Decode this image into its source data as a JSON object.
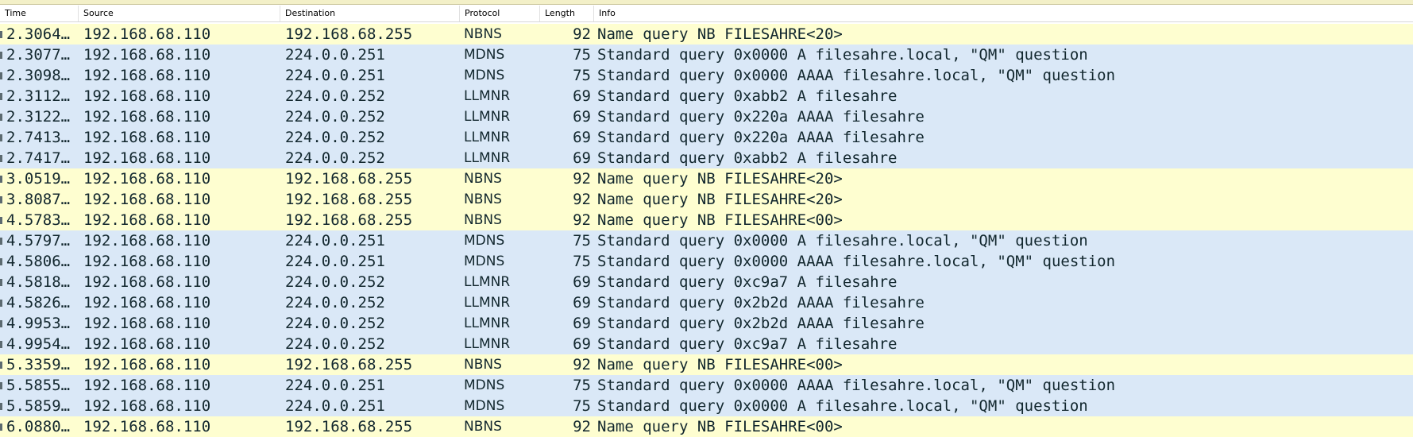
{
  "colors": {
    "nbns_row": "#fefed0",
    "mdns_row": "#dae8f7",
    "llmnr_row": "#dae8f7",
    "row_text": "#12272e"
  },
  "columns": {
    "time": "Time",
    "source": "Source",
    "destination": "Destination",
    "protocol": "Protocol",
    "length": "Length",
    "info": "Info"
  },
  "packets": [
    {
      "time": "2.3064…",
      "source": "192.168.68.110",
      "destination": "192.168.68.255",
      "protocol": "NBNS",
      "length": "92",
      "info": "Name query NB FILESAHRE<20>"
    },
    {
      "time": "2.3077…",
      "source": "192.168.68.110",
      "destination": "224.0.0.251",
      "protocol": "MDNS",
      "length": "75",
      "info": "Standard query 0x0000 A filesahre.local, \"QM\" question"
    },
    {
      "time": "2.3098…",
      "source": "192.168.68.110",
      "destination": "224.0.0.251",
      "protocol": "MDNS",
      "length": "75",
      "info": "Standard query 0x0000 AAAA filesahre.local, \"QM\" question"
    },
    {
      "time": "2.3112…",
      "source": "192.168.68.110",
      "destination": "224.0.0.252",
      "protocol": "LLMNR",
      "length": "69",
      "info": "Standard query 0xabb2 A filesahre"
    },
    {
      "time": "2.3122…",
      "source": "192.168.68.110",
      "destination": "224.0.0.252",
      "protocol": "LLMNR",
      "length": "69",
      "info": "Standard query 0x220a AAAA filesahre"
    },
    {
      "time": "2.7413…",
      "source": "192.168.68.110",
      "destination": "224.0.0.252",
      "protocol": "LLMNR",
      "length": "69",
      "info": "Standard query 0x220a AAAA filesahre"
    },
    {
      "time": "2.7417…",
      "source": "192.168.68.110",
      "destination": "224.0.0.252",
      "protocol": "LLMNR",
      "length": "69",
      "info": "Standard query 0xabb2 A filesahre"
    },
    {
      "time": "3.0519…",
      "source": "192.168.68.110",
      "destination": "192.168.68.255",
      "protocol": "NBNS",
      "length": "92",
      "info": "Name query NB FILESAHRE<20>"
    },
    {
      "time": "3.8087…",
      "source": "192.168.68.110",
      "destination": "192.168.68.255",
      "protocol": "NBNS",
      "length": "92",
      "info": "Name query NB FILESAHRE<20>"
    },
    {
      "time": "4.5783…",
      "source": "192.168.68.110",
      "destination": "192.168.68.255",
      "protocol": "NBNS",
      "length": "92",
      "info": "Name query NB FILESAHRE<00>"
    },
    {
      "time": "4.5797…",
      "source": "192.168.68.110",
      "destination": "224.0.0.251",
      "protocol": "MDNS",
      "length": "75",
      "info": "Standard query 0x0000 A filesahre.local, \"QM\" question"
    },
    {
      "time": "4.5806…",
      "source": "192.168.68.110",
      "destination": "224.0.0.251",
      "protocol": "MDNS",
      "length": "75",
      "info": "Standard query 0x0000 AAAA filesahre.local, \"QM\" question"
    },
    {
      "time": "4.5818…",
      "source": "192.168.68.110",
      "destination": "224.0.0.252",
      "protocol": "LLMNR",
      "length": "69",
      "info": "Standard query 0xc9a7 A filesahre"
    },
    {
      "time": "4.5826…",
      "source": "192.168.68.110",
      "destination": "224.0.0.252",
      "protocol": "LLMNR",
      "length": "69",
      "info": "Standard query 0x2b2d AAAA filesahre"
    },
    {
      "time": "4.9953…",
      "source": "192.168.68.110",
      "destination": "224.0.0.252",
      "protocol": "LLMNR",
      "length": "69",
      "info": "Standard query 0x2b2d AAAA filesahre"
    },
    {
      "time": "4.9954…",
      "source": "192.168.68.110",
      "destination": "224.0.0.252",
      "protocol": "LLMNR",
      "length": "69",
      "info": "Standard query 0xc9a7 A filesahre"
    },
    {
      "time": "5.3359…",
      "source": "192.168.68.110",
      "destination": "192.168.68.255",
      "protocol": "NBNS",
      "length": "92",
      "info": "Name query NB FILESAHRE<00>"
    },
    {
      "time": "5.5855…",
      "source": "192.168.68.110",
      "destination": "224.0.0.251",
      "protocol": "MDNS",
      "length": "75",
      "info": "Standard query 0x0000 AAAA filesahre.local, \"QM\" question"
    },
    {
      "time": "5.5859…",
      "source": "192.168.68.110",
      "destination": "224.0.0.251",
      "protocol": "MDNS",
      "length": "75",
      "info": "Standard query 0x0000 A filesahre.local, \"QM\" question"
    },
    {
      "time": "6.0880…",
      "source": "192.168.68.110",
      "destination": "192.168.68.255",
      "protocol": "NBNS",
      "length": "92",
      "info": "Name query NB FILESAHRE<00>"
    }
  ]
}
